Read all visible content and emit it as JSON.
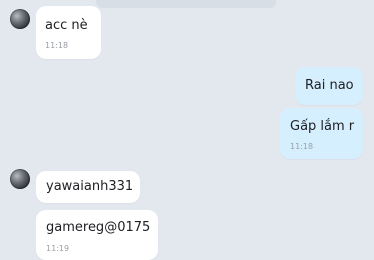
{
  "chat": {
    "messages": [
      {
        "sender": "other",
        "text": "acc nè",
        "time": "11:18"
      },
      {
        "sender": "me",
        "text": "Rai nao",
        "time": ""
      },
      {
        "sender": "me",
        "text": "Gấp lắm r",
        "time": "11:18"
      },
      {
        "sender": "other",
        "text": "yawaianh331",
        "time": ""
      },
      {
        "sender": "other",
        "text": "gamereg@0175",
        "time": "11:19"
      }
    ]
  }
}
